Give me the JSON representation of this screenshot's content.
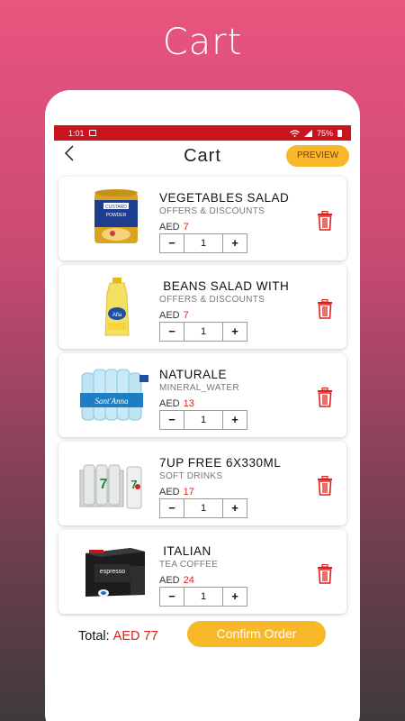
{
  "promo": {
    "title": "Cart"
  },
  "status_bar": {
    "time": "1:01",
    "battery": "75%"
  },
  "header": {
    "title": "Cart",
    "preview_label": "PREVIEW"
  },
  "items": [
    {
      "name": "VEGETABLES SALAD",
      "category": "OFFERS & DISCOUNTS",
      "currency": "AED",
      "price": "7",
      "quantity": "1",
      "image": "custard-powder-can"
    },
    {
      "name": " BEANS SALAD WITH",
      "category": "OFFERS & DISCOUNTS",
      "currency": "AED",
      "price": "7",
      "quantity": "1",
      "image": "oil-bottle"
    },
    {
      "name": "NATURALE",
      "category": "MINERAL_WATER",
      "currency": "AED",
      "price": "13",
      "quantity": "1",
      "image": "water-bottle-pack"
    },
    {
      "name": "7UP FREE 6X330ML",
      "category": "SOFT DRINKS",
      "currency": "AED",
      "price": "17",
      "quantity": "1",
      "image": "soda-can-pack"
    },
    {
      "name": " ITALIAN",
      "category": "TEA COFFEE",
      "currency": "AED",
      "price": "24",
      "quantity": "1",
      "image": "espresso-box"
    }
  ],
  "controls": {
    "minus": "−",
    "plus": "+"
  },
  "footer": {
    "total_label": "Total:",
    "total_value": "AED 77",
    "confirm_label": "Confirm Order"
  },
  "colors": {
    "accent": "#f9b72a",
    "price": "#d9231a",
    "status_bar": "#c8141f"
  }
}
